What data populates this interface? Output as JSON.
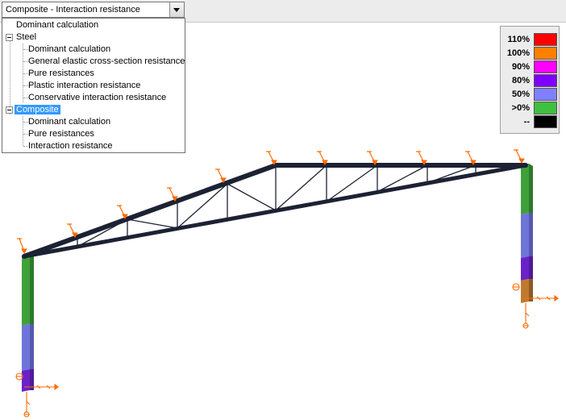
{
  "combo": {
    "selected": "Composite - Interaction resistance"
  },
  "tree": {
    "root_item": "Dominant calculation",
    "steel": {
      "label": "Steel",
      "children": [
        "Dominant calculation",
        "General elastic cross-section resistance",
        "Pure resistances",
        "Plastic interaction resistance",
        "Conservative interaction resistance"
      ]
    },
    "composite": {
      "label": "Composite",
      "children": [
        "Dominant calculation",
        "Pure resistances",
        "Interaction resistance"
      ]
    }
  },
  "legend": [
    {
      "label": "110%",
      "color": "#ff0000"
    },
    {
      "label": "100%",
      "color": "#ff8000"
    },
    {
      "label": "90%",
      "color": "#ff00ff"
    },
    {
      "label": "80%",
      "color": "#8000ff"
    },
    {
      "label": "50%",
      "color": "#8080ff"
    },
    {
      "label": ">0%",
      "color": "#40c040"
    },
    {
      "label": "--",
      "color": "#000000"
    }
  ],
  "colors": {
    "member": "#1c2233",
    "load_arrow": "#ff6a00",
    "selection": "#3399ff"
  }
}
